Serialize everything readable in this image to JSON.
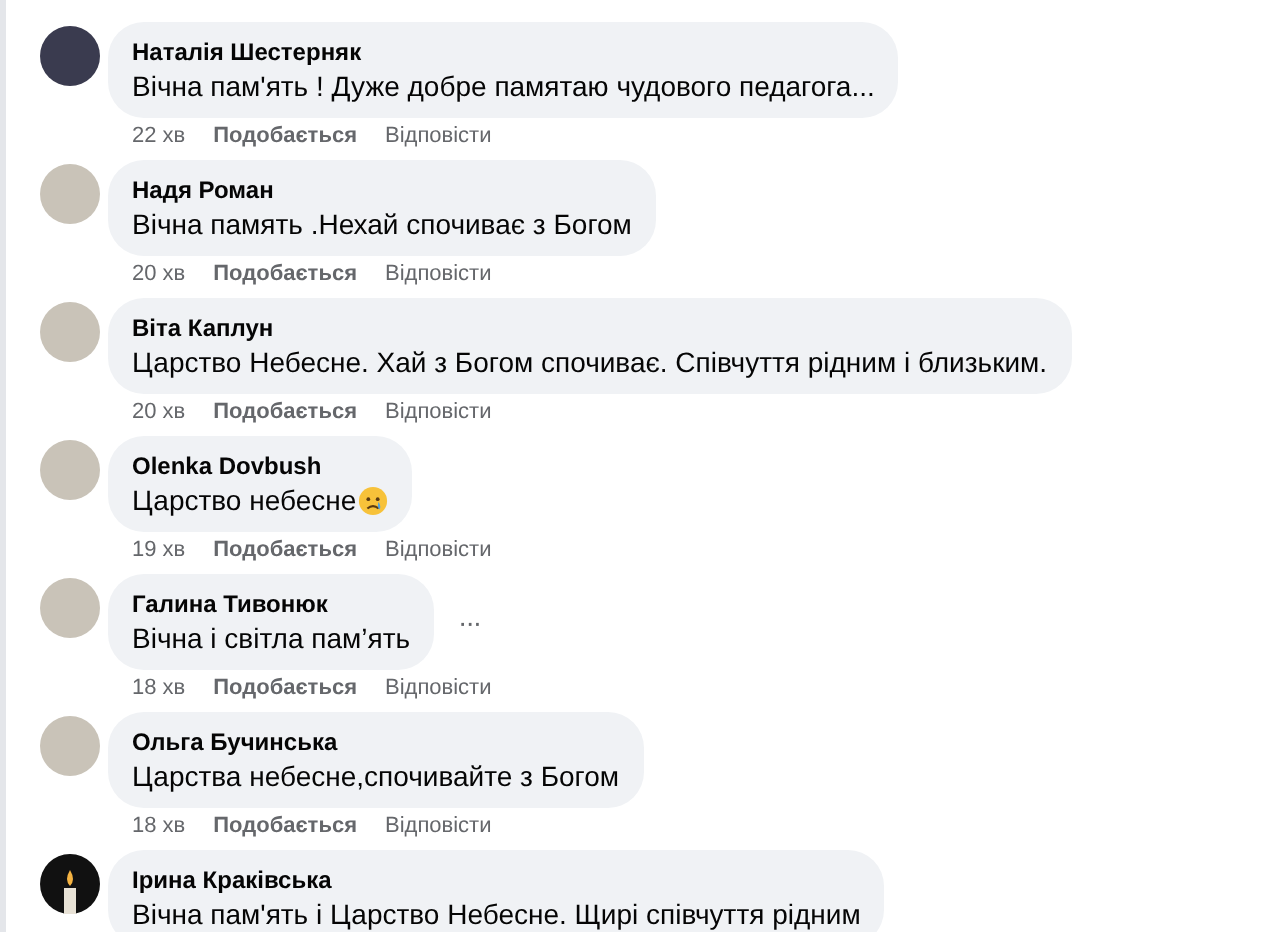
{
  "comments": [
    {
      "author": "Наталія Шестерняк",
      "kind": "dark",
      "text": "Вічна пам'ять ! Дуже добре памятаю чудового педагога...",
      "time": "22 хв",
      "like": "Подобається",
      "reply": "Відповісти"
    },
    {
      "author": "Надя Роман",
      "kind": "photo",
      "text": "Вічна память .Нехай спочиває з Богом",
      "time": "20 хв",
      "like": "Подобається",
      "reply": "Відповісти"
    },
    {
      "author": "Віта Каплун",
      "kind": "photo",
      "text": "Царство Небесне. Хай з Богом спочиває. Співчуття рідним і близьким.",
      "time": "20 хв",
      "like": "Подобається",
      "reply": "Відповісти"
    },
    {
      "author": "Olenka Dovbush",
      "kind": "photo",
      "text": "Царство небесне",
      "emoji": true,
      "time": "19 хв",
      "like": "Подобається",
      "reply": "Відповісти"
    },
    {
      "author": "Галина Тивонюк",
      "kind": "photo",
      "text": "Вічна і світла пам’ять",
      "options": "···",
      "time": "18 хв",
      "like": "Подобається",
      "reply": "Відповісти"
    },
    {
      "author": "Ольга Бучинська",
      "kind": "photo",
      "text": "Царства небесне,спочивайте з Богом",
      "time": "18 хв",
      "like": "Подобається",
      "reply": "Відповісти"
    },
    {
      "author": "Ірина Краківська",
      "kind": "candle",
      "text": "Вічна пам'ять і Царство Небесне. Щирі співчуття рідним"
    }
  ]
}
